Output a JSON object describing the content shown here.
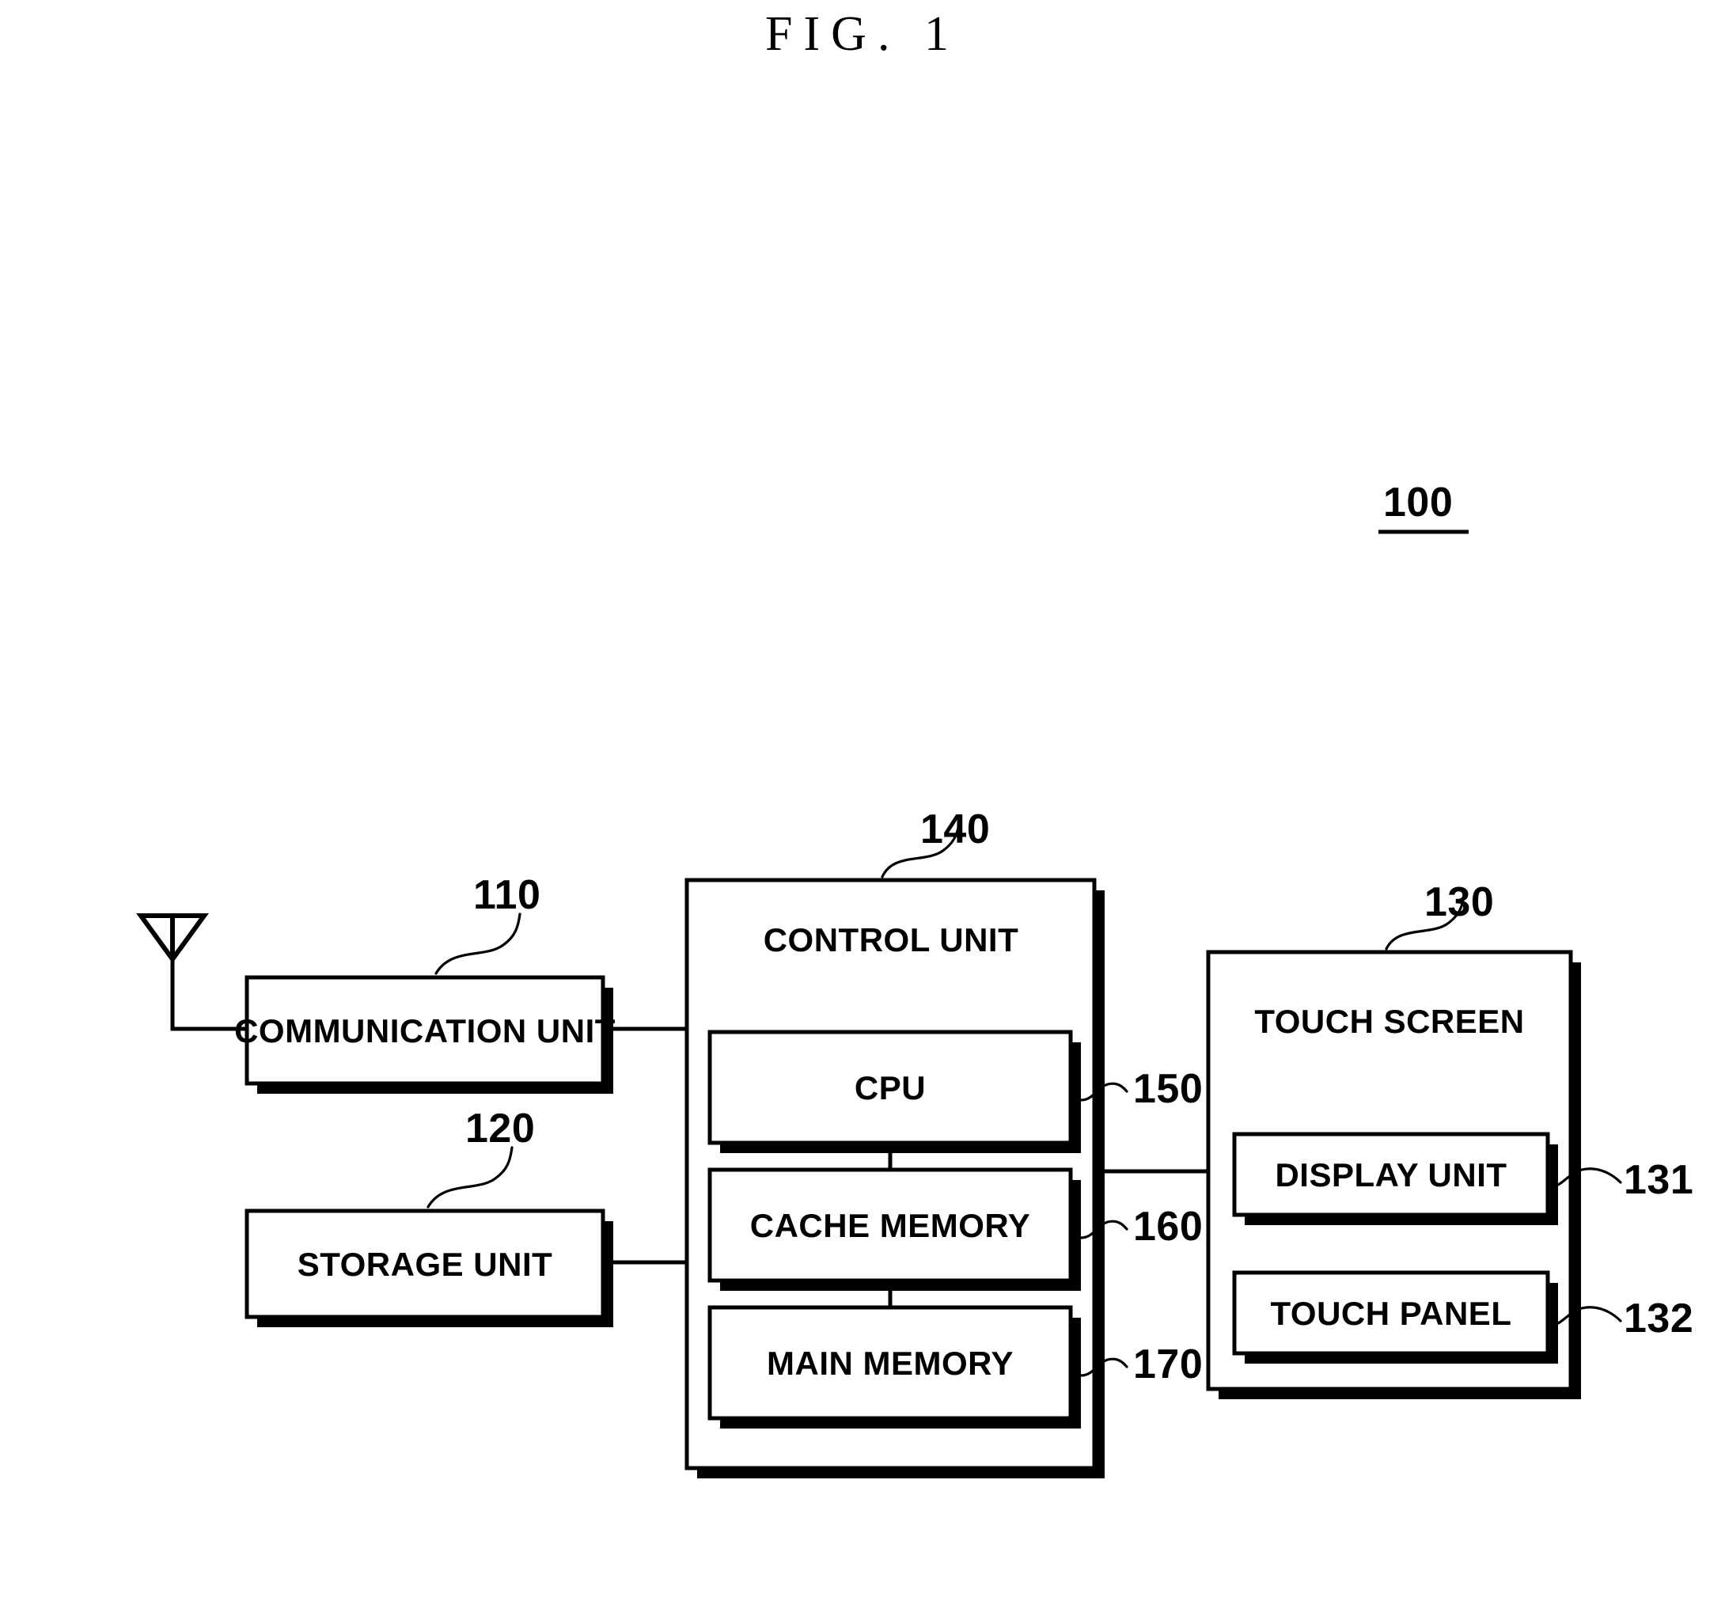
{
  "figure": {
    "title": "FIG. 1",
    "system_ref": "100"
  },
  "blocks": {
    "communication_unit": {
      "label": "COMMUNICATION UNIT",
      "ref": "110"
    },
    "storage_unit": {
      "label": "STORAGE UNIT",
      "ref": "120"
    },
    "control_unit": {
      "label": "CONTROL UNIT",
      "ref": "140"
    },
    "cpu": {
      "label": "CPU",
      "ref": "150"
    },
    "cache_memory": {
      "label": "CACHE MEMORY",
      "ref": "160"
    },
    "main_memory": {
      "label": "MAIN MEMORY",
      "ref": "170"
    },
    "touch_screen": {
      "label": "TOUCH SCREEN",
      "ref": "130"
    },
    "display_unit": {
      "label": "DISPLAY UNIT",
      "ref": "131"
    },
    "touch_panel": {
      "label": "TOUCH PANEL",
      "ref": "132"
    }
  },
  "icons": {
    "antenna": "antenna-icon"
  },
  "colors": {
    "line": "#000000",
    "fill": "#ffffff",
    "background": "#ffffff"
  }
}
